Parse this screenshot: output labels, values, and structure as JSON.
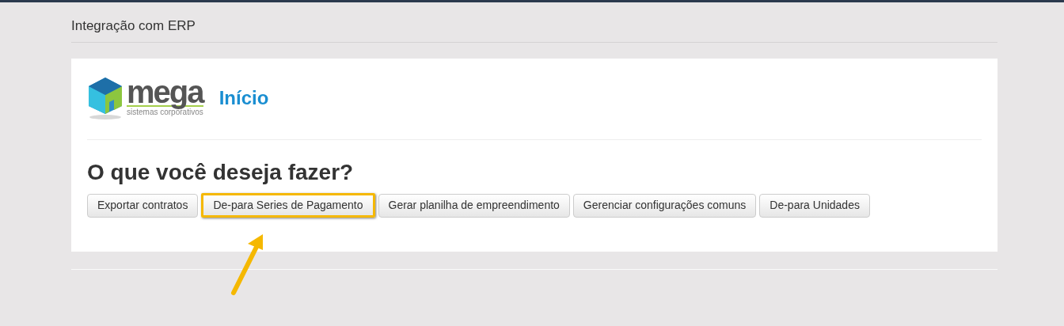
{
  "page_title": "Integração com ERP",
  "logo": {
    "wordmark": "mega",
    "tagline": "sistemas corporativos"
  },
  "section_title": "Início",
  "question": "O que você deseja fazer?",
  "actions": [
    {
      "label": "Exportar contratos",
      "highlighted": false
    },
    {
      "label": "De-para Series de Pagamento",
      "highlighted": true
    },
    {
      "label": "Gerar planilha de empreendimento",
      "highlighted": false
    },
    {
      "label": "Gerenciar configurações comuns",
      "highlighted": false
    },
    {
      "label": "De-para Unidades",
      "highlighted": false
    }
  ]
}
